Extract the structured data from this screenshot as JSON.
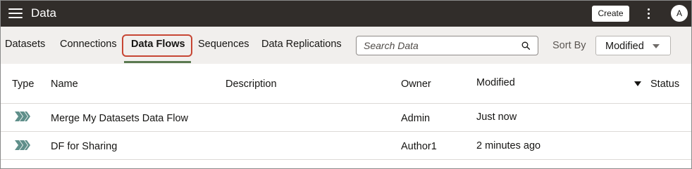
{
  "header": {
    "title": "Data",
    "create_label": "Create",
    "avatar_initial": "A"
  },
  "tabs": [
    {
      "label": "Datasets"
    },
    {
      "label": "Connections"
    },
    {
      "label": "Data Flows",
      "active": true
    },
    {
      "label": "Sequences"
    },
    {
      "label": "Data Replications"
    }
  ],
  "search": {
    "placeholder": "Search Data",
    "value": ""
  },
  "sort": {
    "label": "Sort By",
    "value": "Modified"
  },
  "table": {
    "columns": {
      "type": "Type",
      "name": "Name",
      "description": "Description",
      "owner": "Owner",
      "modified": "Modified",
      "status": "Status"
    },
    "rows": [
      {
        "type_icon": "data-flow-icon",
        "name": "Merge My Datasets Data Flow",
        "description": "",
        "owner": "Admin",
        "modified": "Just now",
        "status": ""
      },
      {
        "type_icon": "data-flow-icon",
        "name": "DF for Sharing",
        "description": "",
        "owner": "Author1",
        "modified": "2 minutes ago",
        "status": ""
      }
    ]
  },
  "colors": {
    "header_bg": "#312d2a",
    "toolbar_bg": "#f1efed",
    "active_tab_focus": "#c74634",
    "active_tab_underline": "#5a7a50",
    "data_flow_icon": "#5f8f8a"
  }
}
